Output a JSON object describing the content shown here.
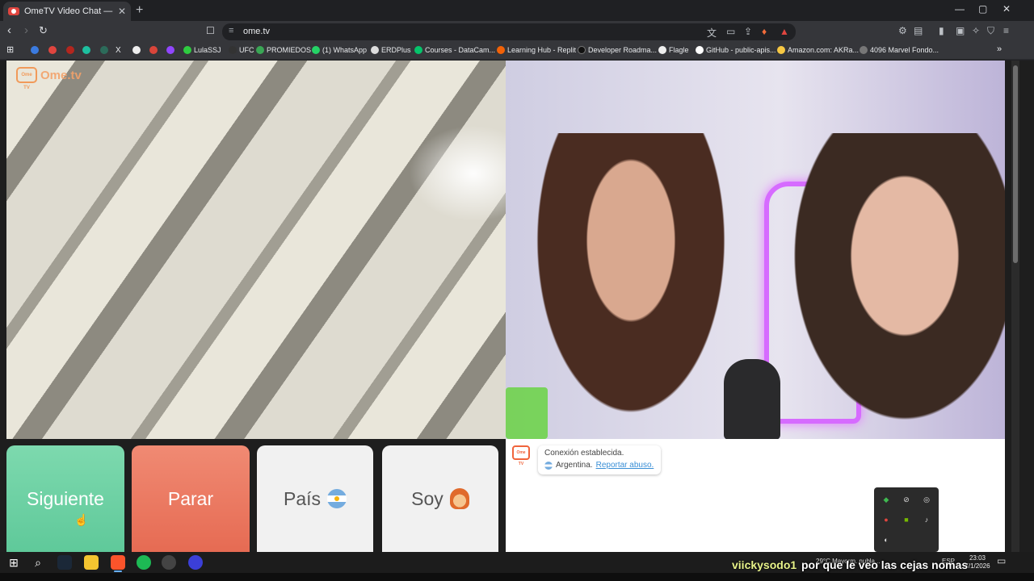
{
  "browser": {
    "tab_title": "OmeTV Video Chat — Omegle",
    "tab_close": "✕",
    "new_tab": "+",
    "url": "ome.tv",
    "window_controls": [
      "—",
      "▢",
      "✕"
    ]
  },
  "bookmarks": [
    {
      "label": "LulaSSJ",
      "color": "#2ecc40"
    },
    {
      "label": "UFC",
      "color": "#333333"
    },
    {
      "label": "PROMIEDOS",
      "color": "#3aa655"
    },
    {
      "label": "(1) WhatsApp",
      "color": "#25d366"
    },
    {
      "label": "ERDPlus",
      "color": "#dddddd"
    },
    {
      "label": "Courses - DataCam...",
      "color": "#05c46b"
    },
    {
      "label": "Learning Hub - Replit",
      "color": "#f26207"
    },
    {
      "label": "Developer Roadma...",
      "color": "#111111"
    },
    {
      "label": "Flagle",
      "color": "#eeeeee"
    },
    {
      "label": "GitHub - public-apis...",
      "color": "#ffffff"
    },
    {
      "label": "Amazon.com: AKRa...",
      "color": "#f7c843"
    },
    {
      "label": "4096 Marvel Fondo...",
      "color": "#777777"
    }
  ],
  "site": {
    "logo_text": "Ome.tv",
    "logo_mark": "Ome TV"
  },
  "controls": {
    "next_label": "Siguiente",
    "stop_label": "Parar",
    "country_label": "País",
    "gender_label": "Soy"
  },
  "chat": {
    "icon_text": "Ome TV",
    "status": "Conexión establecida.",
    "country": "Argentina.",
    "report_link": "Reportar abuso."
  },
  "taskbar": {
    "weather": "29°C  Mayorm. nubla...",
    "language": "ESP",
    "time": "23:03",
    "date": "7/1/2026"
  },
  "overlay": {
    "username": "viickysodo1",
    "message": "por que le veo las cejas nomas"
  },
  "colors": {
    "next_button": "#6fd3a5",
    "stop_button": "#ea7860",
    "accent_orange": "#f0643c",
    "link_blue": "#3a8fd6"
  }
}
